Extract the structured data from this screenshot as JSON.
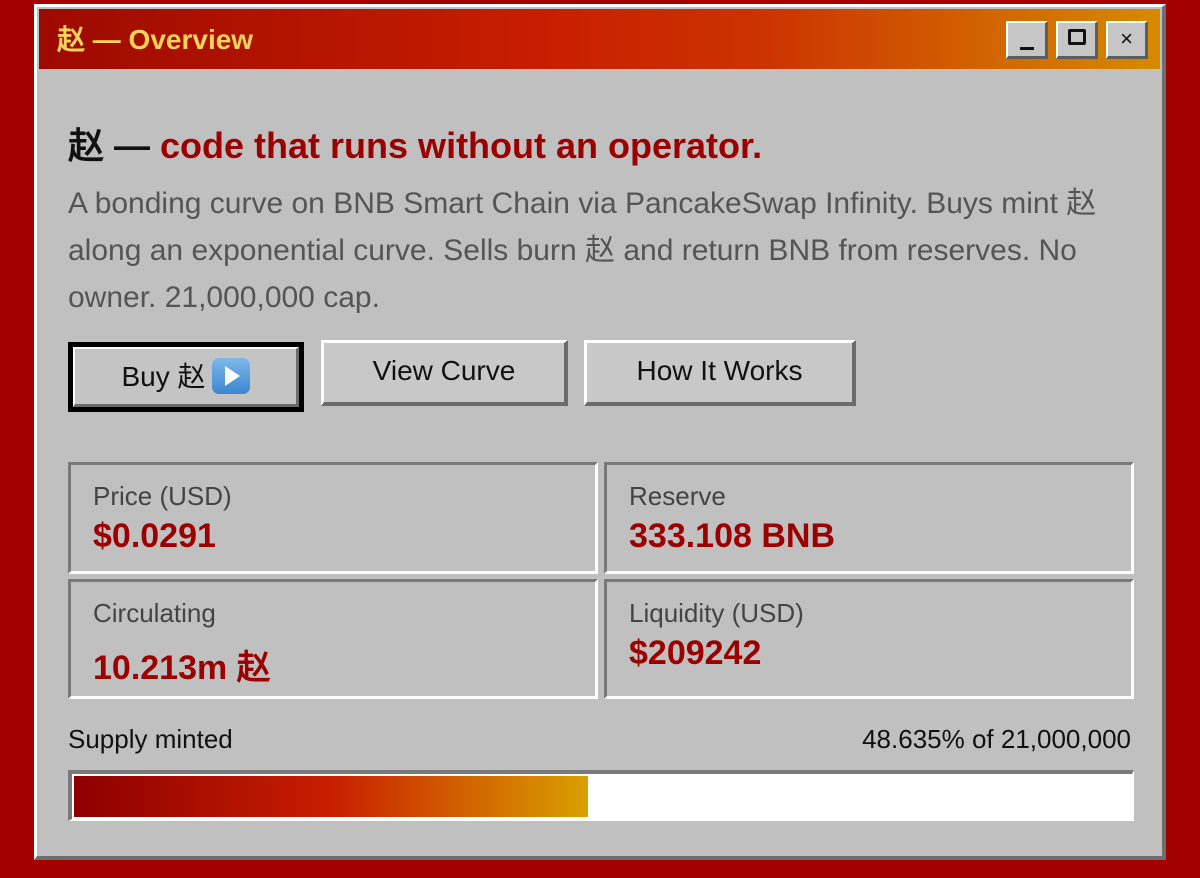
{
  "window": {
    "title": "赵 — Overview",
    "minimize_label": "",
    "maximize_label": "",
    "close_label": "×"
  },
  "hero": {
    "symbol": "赵",
    "dash": " — ",
    "tagline": "code that runs without an operator.",
    "description": "A bonding curve on BNB Smart Chain via PancakeSwap Infinity. Buys mint 赵 along an exponential curve. Sells burn 赵 and return BNB from reserves. No owner. 21,000,000 cap."
  },
  "actions": {
    "buy_label": "Buy 赵",
    "buy_icon": "play-button-icon",
    "curve_label": "View Curve",
    "how_label": "How It Works"
  },
  "stats": {
    "price_label": "Price (USD)",
    "price_value": "$0.0291",
    "reserve_label": "Reserve",
    "reserve_value": "333.108 BNB",
    "circulating_label": "Circulating",
    "circulating_value": "10.213m 赵",
    "liquidity_label": "Liquidity (USD)",
    "liquidity_value": "$209242"
  },
  "supply": {
    "label": "Supply minted",
    "summary": "48.635% of 21,000,000",
    "fraction": 0.48635
  },
  "colors": {
    "accent": "#9b0000",
    "title_text": "#f6d35b",
    "background": "#a50000",
    "window": "#c0c0c0"
  }
}
